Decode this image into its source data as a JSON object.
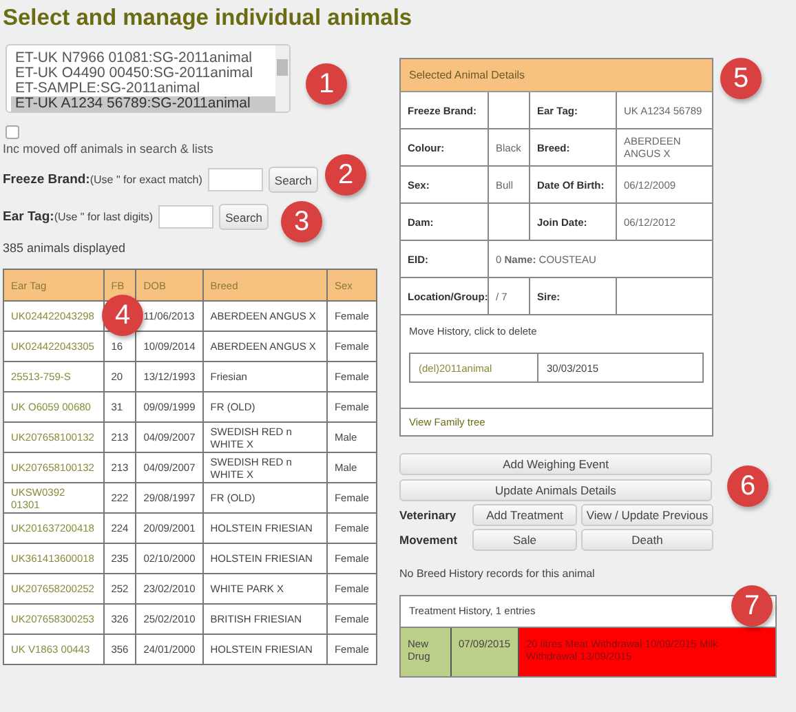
{
  "title": "Select and manage individual animals",
  "animal_list": [
    {
      "label": "ET-UK N7966 01081:SG-2011animal",
      "selected": false
    },
    {
      "label": "ET-UK O4490 00450:SG-2011animal",
      "selected": false
    },
    {
      "label": "ET-SAMPLE:SG-2011animal",
      "selected": false
    },
    {
      "label": "ET-UK A1234 56789:SG-2011animal",
      "selected": true
    }
  ],
  "include_moved_off": {
    "label": "Inc moved off animals in search & lists",
    "checked": false
  },
  "searches": [
    {
      "label": "Freeze Brand:",
      "hint": "(Use \" for exact match)",
      "button": "Search"
    },
    {
      "label": "Ear Tag:",
      "hint": "(Use \" for last digits)",
      "button": "Search"
    }
  ],
  "count_text": "385 animals displayed",
  "table": {
    "columns": [
      "Ear Tag",
      "FB",
      "DOB",
      "Breed",
      "Sex"
    ],
    "rows": [
      [
        "UK024422043298",
        "",
        "11/06/2013",
        "ABERDEEN ANGUS X",
        "Female"
      ],
      [
        "UK024422043305",
        "16",
        "10/09/2014",
        "ABERDEEN ANGUS X",
        "Female"
      ],
      [
        "25513-759-S",
        "20",
        "13/12/1993",
        "Friesian",
        "Female"
      ],
      [
        "UK O6059 00680",
        "31",
        "09/09/1999",
        "FR (OLD)",
        "Female"
      ],
      [
        "UK207658100132",
        "213",
        "04/09/2007",
        "SWEDISH RED n WHITE X",
        "Male"
      ],
      [
        "UK207658100132",
        "213",
        "04/09/2007",
        "SWEDISH RED n WHITE X",
        "Male"
      ],
      [
        "UKSW0392 01301",
        "222",
        "29/08/1997",
        "FR (OLD)",
        "Female"
      ],
      [
        "UK201637200418",
        "224",
        "20/09/2001",
        "HOLSTEIN FRIESIAN",
        "Female"
      ],
      [
        "UK361413600018",
        "235",
        "02/10/2000",
        "HOLSTEIN FRIESIAN",
        "Female"
      ],
      [
        "UK207658200252",
        "252",
        "23/02/2010",
        "WHITE PARK X",
        "Female"
      ],
      [
        "UK207658300253",
        "326",
        "25/02/2010",
        "BRITISH FRIESIAN",
        "Female"
      ],
      [
        "UK V1863 00443",
        "356",
        "24/01/2000",
        "HOLSTEIN FRIESIAN",
        "Female"
      ]
    ]
  },
  "details": {
    "title": "Selected Animal Details",
    "rows": [
      [
        {
          "kind": "label",
          "text": "Freeze Brand:"
        },
        {
          "kind": "value"
        },
        {
          "kind": "label",
          "text": "Ear Tag:"
        },
        {
          "kind": "value",
          "text": "UK A1234 56789"
        }
      ],
      [
        {
          "kind": "label",
          "text": "Colour:"
        },
        {
          "kind": "value",
          "text": "Black"
        },
        {
          "kind": "label",
          "text": "Breed:"
        },
        {
          "kind": "value",
          "text": "ABERDEEN ANGUS X"
        }
      ],
      [
        {
          "kind": "label",
          "text": "Sex:"
        },
        {
          "kind": "value",
          "text": "Bull"
        },
        {
          "kind": "label",
          "text": "Date Of Birth:"
        },
        {
          "kind": "value",
          "text": "06/12/2009"
        }
      ],
      [
        {
          "kind": "label",
          "text": "Dam:"
        },
        {
          "kind": "value"
        },
        {
          "kind": "label",
          "text": "Join Date:"
        },
        {
          "kind": "value",
          "text": "06/12/2012"
        }
      ],
      [
        {
          "kind": "label",
          "text": "EID:"
        },
        {
          "kind": "wide",
          "text": "0 **Name:** COUSTEAU"
        }
      ],
      [
        {
          "kind": "label",
          "text": "Location/Group:"
        },
        {
          "kind": "value",
          "text": "/ 7"
        },
        {
          "kind": "label",
          "text": "Sire:"
        },
        {
          "kind": "value"
        }
      ]
    ],
    "move_history_text": "Move History, click to delete",
    "moves": [
      {
        "name": "(del)2011animal",
        "date": "30/03/2015"
      }
    ],
    "family_tree_link": "View Family tree"
  },
  "wide_buttons": [
    "Add Weighing Event",
    "Update Animals Details"
  ],
  "button_groups": [
    {
      "label": "Veterinary",
      "buttons": [
        "Add Treatment",
        "View / Update Previous"
      ]
    },
    {
      "label": "Movement",
      "buttons": [
        "Sale",
        "Death"
      ]
    }
  ],
  "breed_note": "No Breed History records for this animal",
  "treatment": {
    "title": "Treatment History, 1 entries",
    "rows": [
      {
        "drug": "New Drug",
        "date": "07/09/2015",
        "note": "20 litres Meat Withdrawal 10/09/2015 Milk Withdrawal 13/09/2015"
      }
    ]
  },
  "callouts": [
    "1",
    "2",
    "3",
    "4",
    "5",
    "6",
    "7"
  ]
}
